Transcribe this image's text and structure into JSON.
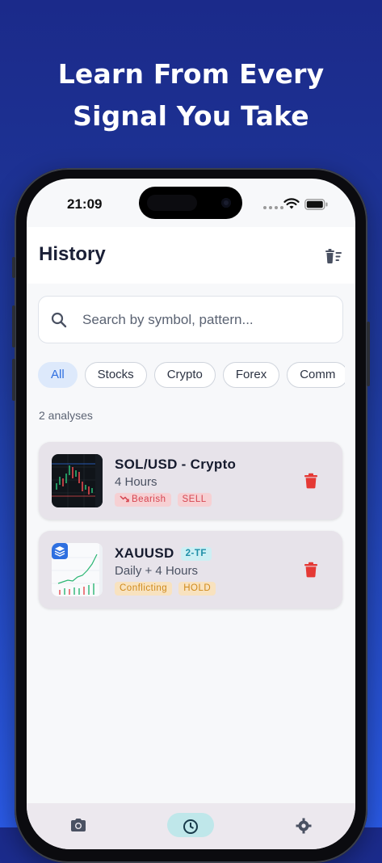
{
  "headline": {
    "line1": "Learn From Every",
    "line2": "Signal You Take"
  },
  "status": {
    "time": "21:09"
  },
  "header": {
    "title": "History",
    "clear_icon": "clear-history-icon"
  },
  "search": {
    "placeholder": "Search by symbol, pattern..."
  },
  "filters": {
    "chips": [
      "All",
      "Stocks",
      "Crypto",
      "Forex",
      "Comm"
    ],
    "selected": "All"
  },
  "summary": {
    "count_label": "2 analyses"
  },
  "analyses": [
    {
      "title": "SOL/USD - Crypto",
      "timeframe": "4 Hours",
      "trend_label": "Bearish",
      "signal": "SELL"
    },
    {
      "title": "XAUUSD",
      "tf_badge": "2-TF",
      "timeframe": "Daily + 4 Hours",
      "trend_label": "Conflicting",
      "signal": "HOLD"
    }
  ],
  "colors": {
    "accent": "#2e6fe0",
    "bearish": "#d64550",
    "hold": "#d08a1b",
    "delete": "#e53935"
  }
}
